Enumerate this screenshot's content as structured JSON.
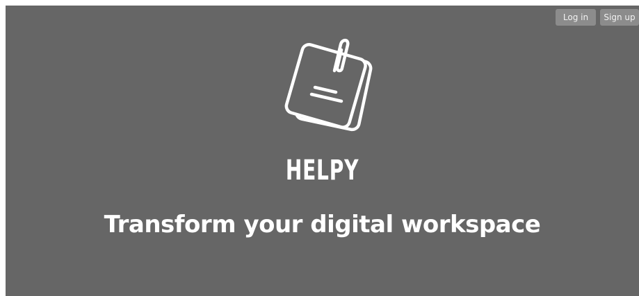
{
  "auth": {
    "login_label": "Log in",
    "signup_label": "Sign up"
  },
  "hero": {
    "logo_icon": "sticky-notes-clip-icon",
    "brand_name": "HELPY",
    "tagline": "Transform your digital workspace"
  },
  "colors": {
    "background": "#666666",
    "button_bg": "#8c8c8c",
    "text": "#ffffff"
  }
}
